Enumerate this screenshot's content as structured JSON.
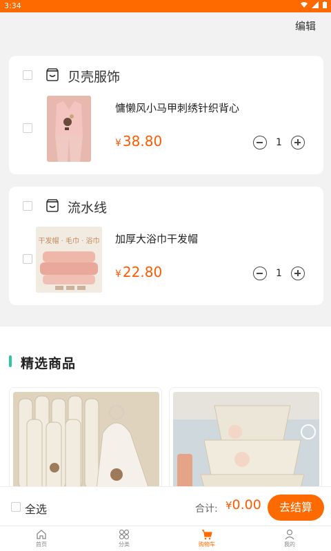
{
  "status_bar": {
    "time": "3:34"
  },
  "header": {
    "edit_label": "编辑"
  },
  "cart": {
    "shops": [
      {
        "name": "贝壳服饰",
        "item": {
          "title": "慵懒风小马甲刺绣针织背心",
          "currency": "¥",
          "price": "38.80",
          "quantity": "1"
        }
      },
      {
        "name": "流水线",
        "item": {
          "title": "加厚大浴巾干发帽",
          "currency": "¥",
          "price": "22.80",
          "quantity": "1",
          "image_text": "干发帽 · 毛巾 · 浴巾"
        }
      }
    ]
  },
  "recommend": {
    "title": "精选商品"
  },
  "checkout": {
    "select_all_label": "全选",
    "total_label": "合计:",
    "currency": "¥",
    "total_value": "0.00",
    "button_label": "去结算"
  },
  "tabbar": {
    "items": [
      {
        "label": "首页",
        "icon": "home-icon"
      },
      {
        "label": "分类",
        "icon": "category-icon"
      },
      {
        "label": "购物车",
        "icon": "cart-icon",
        "active": true
      },
      {
        "label": "我的",
        "icon": "user-icon"
      }
    ]
  },
  "colors": {
    "accent": "#ff6a00",
    "price": "#ff5a00",
    "section_marker": "#2ec7a4"
  }
}
